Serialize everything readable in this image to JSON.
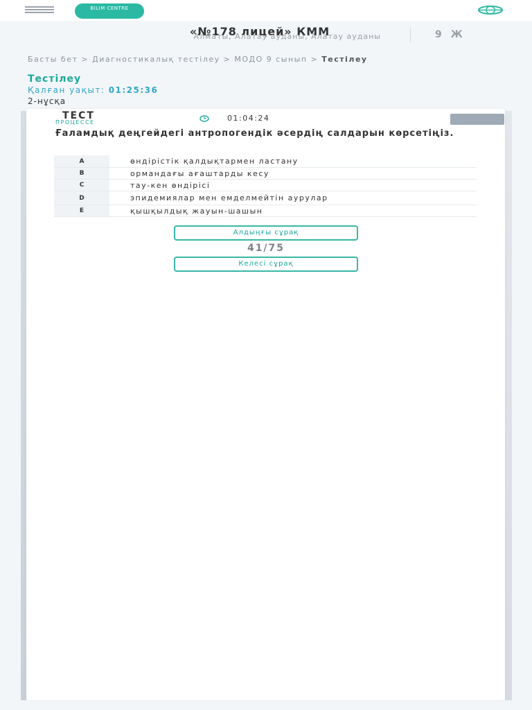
{
  "header": {
    "logo_text": "BILIM CENTRE",
    "icons": {
      "menu": "hamburger-menu-icon",
      "globe": "globe-icon"
    },
    "accent_color": "#2bb9a4"
  },
  "school": {
    "name": "«№178 лицей» КММ",
    "address": "Алматы, Алатау ауданы, Алатау ауданы",
    "grade": "9 Ж"
  },
  "breadcrumb": {
    "home": "Басты бет",
    "separator": ">",
    "section": "Диагностикалық тестілеу",
    "subsection": "МОДО 9 сынып",
    "current": "Тестілеу"
  },
  "page_title": "Тестілеу",
  "remaining_time": {
    "label": "Қалған уақыт:",
    "value": "01:25:36"
  },
  "variant": "2-нұсқа",
  "test": {
    "label": "ТЕСТ",
    "status": "ПРОЦЕССЕ",
    "elapsed": "01:04:24",
    "question": "Ғаламдық деңгейдегі антропогендік әсердің салдарын көрсетіңіз.",
    "answers": [
      {
        "letter": "A",
        "text": "өндірістік қалдықтармен ластану"
      },
      {
        "letter": "B",
        "text": "ормандағы ағаштарды кесу"
      },
      {
        "letter": "C",
        "text": "тау-кен өндірісі"
      },
      {
        "letter": "D",
        "text": "эпидемиялар мен емделмейтін аурулар"
      },
      {
        "letter": "E",
        "text": "қышқылдық жауын-шашын"
      }
    ],
    "prev_button": "Алдыңғы сұрақ",
    "next_button": "Келесі сұрақ",
    "counter": "41/75"
  }
}
